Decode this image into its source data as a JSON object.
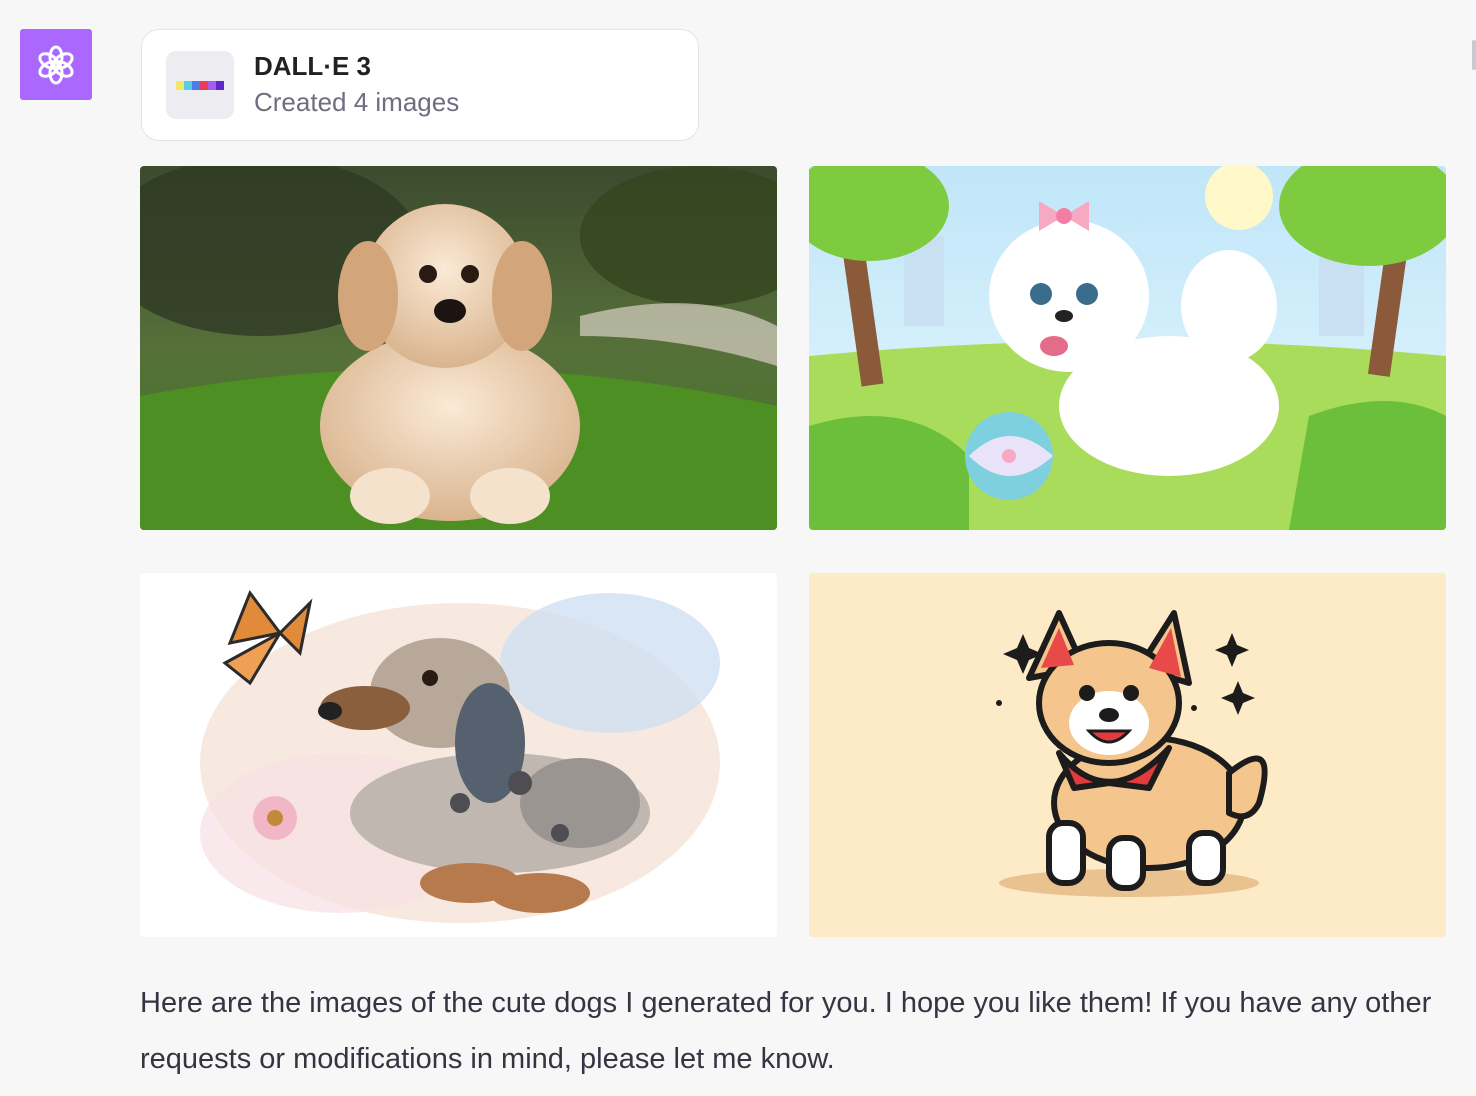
{
  "assistant": {
    "avatar_icon": "openai-logo-icon",
    "avatar_color": "#ab68ff"
  },
  "tool_card": {
    "title": "DALL·E 3",
    "subtitle": "Created 4 images",
    "thumb_icon": "color-stripe-icon",
    "stripe_colors": [
      "#f5e663",
      "#56d0e0",
      "#4b7bec",
      "#a55eea",
      "#eb3b5a",
      "#5f27cd"
    ]
  },
  "images": [
    {
      "subject_icon": "photo-golden-puppy"
    },
    {
      "subject_icon": "cartoon-white-pomeranian"
    },
    {
      "subject_icon": "watercolor-dachshund-butterfly"
    },
    {
      "subject_icon": "cartoon-corgi-bandana"
    }
  ],
  "message": {
    "text": "Here are the images of the cute dogs I generated for you. I hope you like them! If you have any other requests or modifications in mind, please let me know."
  }
}
